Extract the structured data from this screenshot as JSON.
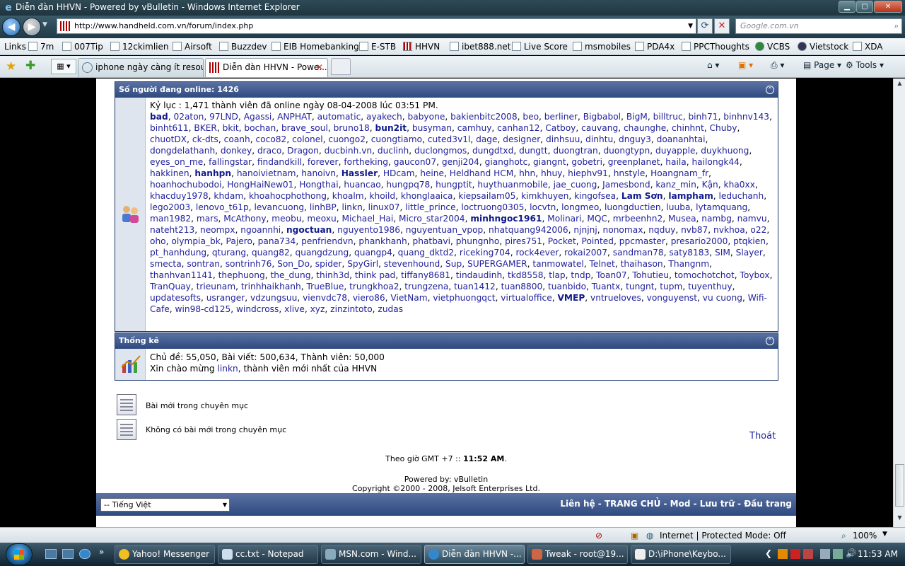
{
  "window": {
    "title": "Diễn đàn HHVN - Powered by vBulletin - Windows Internet Explorer",
    "min": "▁",
    "max": "▢",
    "close": "✕"
  },
  "address": {
    "url": "http://www.handheld.com.vn/forum/index.php",
    "search_placeholder": "Google.com.vn"
  },
  "links": {
    "label": "Links",
    "items": [
      "7m",
      "007Tip",
      "12ckimlien",
      "Airsoft",
      "Buzzdev",
      "EIB Homebanking",
      "E-STB",
      "HHVN",
      "ibet888.net",
      "Live Score",
      "msmobiles",
      "PDA4x",
      "PPCThoughts",
      "VCBS",
      "Vietstock",
      "XDA"
    ]
  },
  "tabs": [
    {
      "label": "iphone ngày càng ít resour..."
    },
    {
      "label": "Diễn đàn HHVN - Powe..."
    }
  ],
  "commands": {
    "page": "Page",
    "tools": "Tools"
  },
  "online": {
    "header": "Số người đang online: 1426",
    "record": "Kỷ lục : 1,471 thành viên đã online ngày 08-04-2008 lúc 03:51 PM.",
    "users": [
      [
        "bad",
        "b"
      ],
      "02aton",
      "97LND",
      "Agassi",
      "ANPHAT",
      "automatic",
      "ayakech",
      "babyone",
      "bakienbitc2008",
      "beo",
      "berliner",
      "Bigbabol",
      "BigM",
      "billtruc",
      "binh71",
      "binhnv143",
      "binht611",
      "BKER",
      "bkit",
      "bochan",
      "brave_soul",
      "bruno18",
      [
        "bun2it",
        "b"
      ],
      "busyman",
      "camhuy",
      "canhan12",
      "Catboy",
      "cauvang",
      "chaunghe",
      "chinhnt",
      "Chuby",
      "chuotDX",
      "ck-dts",
      "coanh",
      "coco82",
      "colonel",
      "cuongo2",
      "cuongtiamo",
      "cuted3v1l",
      "dage",
      "designer",
      "dinhsuu",
      "dinhtu",
      "dnguy3",
      "doananhtai",
      "dongdelathanh",
      "donkey",
      "draco",
      "Dragon",
      "ducbinh.vn",
      "duclinh",
      "duclongmos",
      "dungdtxd",
      "dungtt",
      "duongtran",
      "duongtypn",
      "duyapple",
      "duykhuong",
      "eyes_on_me",
      "fallingstar",
      "findandkill",
      "forever",
      "fortheking",
      "gaucon07",
      "genji204",
      "gianghotc",
      "giangnt",
      "gobetri",
      "greenplanet",
      "haila",
      "hailongk44",
      "hakkinen",
      [
        "hanhpn",
        "b"
      ],
      "hanoivietnam",
      "hanoivn",
      [
        "Hassler",
        "b"
      ],
      "HDcam",
      "heine",
      "Heldhand HCM",
      "hhn",
      "hhuy",
      "hiephv91",
      "hnstyle",
      "Hoangnam_fr",
      "hoanhochubodoi",
      "HongHaiNew01",
      "Hongthai",
      "huancao",
      "hungpq78",
      "hungptit",
      "huythuanmobile",
      "jae_cuong",
      "Jamesbond",
      "kanz_min",
      "Kận",
      "kha0xx",
      "khacduy1978",
      "khdam",
      "khoahocphothong",
      "khoalm",
      "khoild",
      "khonglaaica",
      "kiepsailam05",
      "kimkhuyen",
      "kingofsea",
      [
        "Lam Sơn",
        "b"
      ],
      [
        "lampham",
        "b"
      ],
      "leduchanh",
      "lego2003",
      "lenovo_t61p",
      "levancuong",
      "linhBP",
      "linkn",
      "linux07",
      "little_prince",
      "loctruong0305",
      "locvtn",
      "longmeo",
      "luongductien",
      "luuba",
      "lytamquang",
      "man1982",
      "mars",
      "McAthony",
      "meobu",
      "meoxu",
      "Michael_Hai",
      "Micro_star2004",
      [
        "minhngoc1961",
        "b"
      ],
      "Molinari",
      "MQC",
      "mrbeenhn2",
      "Musea",
      "nambg",
      "namvu",
      "nateht213",
      "neompx",
      "ngoannhi",
      [
        "ngoctuan",
        "b"
      ],
      "nguyento1986",
      "nguyentuan_vpop",
      "nhatquang942006",
      "njnjnj",
      "nonomax",
      "nqduy",
      "nvb87",
      "nvkhoa",
      "o22",
      "oho",
      "olympia_bk",
      "Pajero",
      "pana734",
      "penfriendvn",
      "phankhanh",
      "phatbavi",
      "phungnho",
      "pires751",
      "Pocket",
      "Pointed",
      "ppcmaster",
      "presario2000",
      "ptqkien",
      "pt_hanhdung",
      "qturang",
      "quang82",
      "quangdzung",
      "quangp4",
      "quang_dktd2",
      "riceking704",
      "rock4ever",
      "rokai2007",
      "sandman78",
      "saty8183",
      "SIM",
      "Slayer",
      "smecta",
      "sontran",
      "sontrinh76",
      "Son_Do",
      "spider",
      "SpyGirl",
      "stevenhound",
      "Sup",
      "SUPERGAMER",
      "tanmowatel",
      "Telnet",
      "thaihason",
      "Thangnm",
      "thanhvan1141",
      "thephuong",
      "the_dung",
      "thinh3d",
      "think pad",
      "tiffany8681",
      "tindaudinh",
      "tkd8558",
      "tlap",
      "tndp",
      "Toan07",
      "Tohutieu",
      "tomochotchot",
      "Toybox",
      "TranQuay",
      "trieunam",
      "trinhhaikhanh",
      "TrueBlue",
      "trungkhoa2",
      "trungzena",
      "tuan1412",
      "tuan8800",
      "tuanbido",
      "Tuantx",
      "tungnt",
      "tupm",
      "tuyenthuy",
      "updatesofts",
      "usranger",
      "vdzungsuu",
      "vienvdc78",
      "viero86",
      "VietNam",
      "vietphuongqct",
      "virtualoffice",
      [
        "VMEP",
        "b"
      ],
      "vntrueloves",
      "vonguyenst",
      "vu cuong",
      "Wifi-Cafe",
      "win98-cd125",
      "windcross",
      "xlive",
      "xyz",
      "zinzintoto",
      "zudas"
    ]
  },
  "stats": {
    "header": "Thống kê",
    "line1": "Chủ đề: 55,050, Bài viết: 500,634, Thành viên: 50,000",
    "welcome_pre": "Xin chào mừng ",
    "newest": "linkn",
    "welcome_post": ", thành viên mới nhất của HHVN"
  },
  "legend": {
    "new_posts": "Bài mới trong chuyên mục",
    "no_new_posts": "Không có bài mới trong chuyên mục"
  },
  "logout": "Thoát",
  "time": {
    "pre": "Theo giờ GMT +7 :: ",
    "time": "11:52 AM",
    "post": "."
  },
  "powered": {
    "line1": "Powered by: vBulletin",
    "line2": "Copyright ©2000 - 2008, Jelsoft Enterprises Ltd."
  },
  "footer": {
    "language": "-- Tiếng Việt",
    "links": "Liên hệ - TRANG CHỦ - Mod - Lưu trữ - Đầu trang"
  },
  "status": {
    "zone": "Internet | Protected Mode: Off",
    "zoom": "100%"
  },
  "taskbar": {
    "buttons": [
      "Yahoo! Messenger",
      "cc.txt - Notepad",
      "MSN.com - Wind...",
      "Diễn đàn HHVN -...",
      "Tweak - root@19...",
      "D:\\iPhone\\Keybo..."
    ],
    "clock": "11:53 AM"
  },
  "colors": {
    "link": "#22229c",
    "header": "#2f4a80",
    "bold_user": "#101a8a"
  }
}
